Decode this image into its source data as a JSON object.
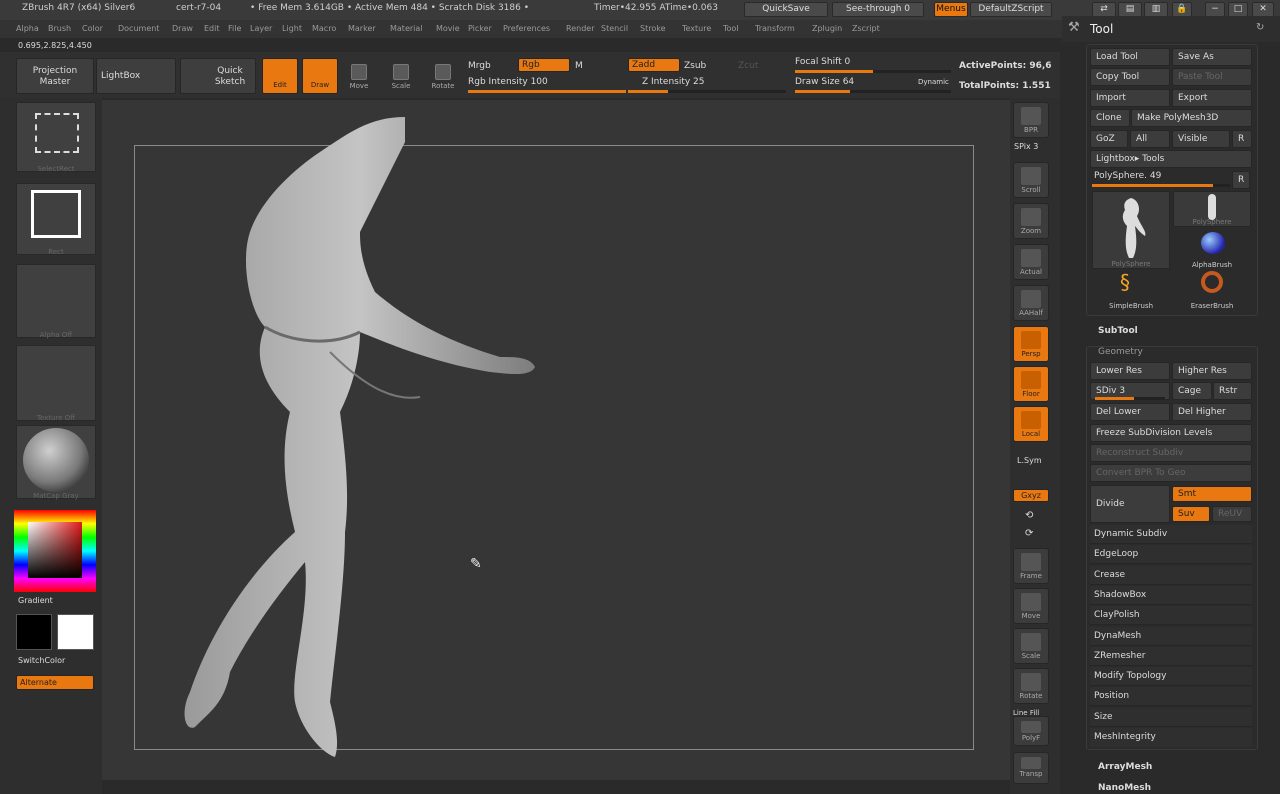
{
  "titlebar": {
    "app": "ZBrush 4R7 (x64) Silver6",
    "doc": "cert-r7-04",
    "stats": "• Free Mem 3.614GB • Active Mem 484 • Scratch Disk 3186 •",
    "timer": "Timer•42.955 ATime•0.063",
    "quicksave": "QuickSave",
    "seethrough": "See-through  0",
    "menus": "Menus",
    "zscript": "DefaultZScript"
  },
  "menubar": [
    "Alpha",
    "Brush",
    "Color",
    "Document",
    "Draw",
    "Edit",
    "File",
    "Layer",
    "Light",
    "Macro",
    "Marker",
    "Material",
    "Movie",
    "Picker",
    "Preferences",
    "Render",
    "Stencil",
    "Stroke",
    "Texture",
    "Tool",
    "Transform",
    "Zplugin",
    "Zscript"
  ],
  "coords": "0.695,2.825,4.450",
  "topshelf": {
    "projection_master": "Projection Master",
    "lightbox": "LightBox",
    "quick_sketch": "Quick Sketch",
    "edit": "Edit",
    "draw": "Draw",
    "move": "Move",
    "scale": "Scale",
    "rotate": "Rotate",
    "mrgb": "Mrgb",
    "rgb": "Rgb",
    "m": "M",
    "rgb_intensity": "Rgb Intensity 100",
    "zadd": "Zadd",
    "zsub": "Zsub",
    "zcut": "Zcut",
    "z_intensity": "Z Intensity 25",
    "focal_shift": "Focal Shift 0",
    "draw_size": "Draw Size 64",
    "dynamic": "Dynamic",
    "active_points": "ActivePoints: 96,6",
    "total_points": "TotalPoints: 1.551",
    "rgb_intensity_level": 1.0,
    "z_intensity_level": 0.25,
    "focal_level": 0.5,
    "draw_size_level": 0.35
  },
  "leftshelf": {
    "brush_caption": "SelectRect",
    "stroke_caption": "Rect",
    "alpha_caption": "Alpha Off",
    "texture_caption": "Texture Off",
    "material_caption": "MatCap Gray",
    "gradient": "Gradient",
    "switchcolor": "SwitchColor",
    "alternate": "Alternate"
  },
  "rightshelf": {
    "bpr": "BPR",
    "spix": "SPix 3",
    "scroll": "Scroll",
    "zoom": "Zoom",
    "actual": "Actual",
    "aahalf": "AAHalf",
    "persp": "Persp",
    "floor": "Floor",
    "local": "Local",
    "lsym": "L.Sym",
    "xyz": "Gxyz",
    "frame": "Frame",
    "move": "Move",
    "scale": "Scale",
    "rotate": "Rotate",
    "linefill": "Line Fill",
    "polyf": "PolyF",
    "transp": "Transp"
  },
  "tool": {
    "title": "Tool",
    "load_tool": "Load Tool",
    "save_as": "Save As",
    "copy_tool": "Copy Tool",
    "paste_tool": "Paste Tool",
    "import": "Import",
    "export": "Export",
    "clone": "Clone",
    "make_polymesh": "Make PolyMesh3D",
    "goz": "GoZ",
    "all": "All",
    "visible": "Visible",
    "r": "R",
    "lightbox_tools": "Lightbox▸ Tools",
    "polysphere": "PolySphere. 49",
    "thumbs": [
      "PolySphere",
      "PolySphere",
      "AlphaBrush",
      "SimpleBrush",
      "EraserBrush"
    ],
    "subtool": "SubTool",
    "geometry": "Geometry",
    "lower_res": "Lower Res",
    "higher_res": "Higher Res",
    "sdiv": "SDiv 3",
    "cage": "Cage",
    "rstr": "Rstr",
    "del_lower": "Del Lower",
    "del_higher": "Del Higher",
    "freeze": "Freeze SubDivision Levels",
    "reconstruct": "Reconstruct Subdiv",
    "convert_bpr": "Convert BPR To Geo",
    "divide": "Divide",
    "smt": "Smt",
    "suv": "Suv",
    "reuv": "ReUV",
    "sections": [
      "Dynamic Subdiv",
      "EdgeLoop",
      "Crease",
      "ShadowBox",
      "ClayPolish",
      "DynaMesh",
      "ZRemesher",
      "Modify Topology",
      "Position",
      "Size",
      "MeshIntegrity"
    ],
    "arraymesh": "ArrayMesh",
    "nanomesh": "NanoMesh"
  }
}
